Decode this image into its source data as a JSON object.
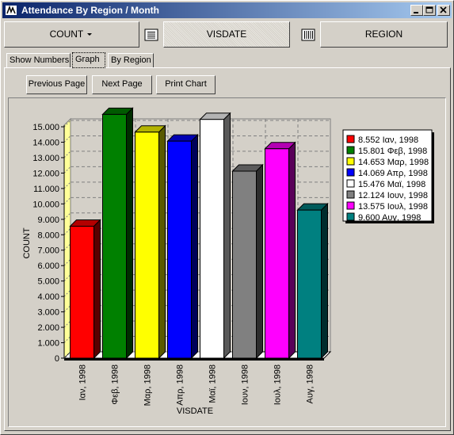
{
  "window": {
    "title": "Attendance By Region / Month"
  },
  "toolbar": {
    "count_label": "COUNT",
    "visdate_label": "VISDATE",
    "region_label": "REGION"
  },
  "tabs": [
    {
      "label": "Show Numbers",
      "selected": false
    },
    {
      "label": "Graph",
      "selected": true
    },
    {
      "label": "By Region",
      "selected": false
    }
  ],
  "nav": {
    "previous_label": "Previous Page",
    "next_label": "Next Page",
    "print_label": "Print Chart"
  },
  "chart_data": {
    "type": "bar",
    "categories": [
      "Ιαν, 1998",
      "Φεβ, 1998",
      "Μαρ, 1998",
      "Απρ, 1998",
      "Μαϊ, 1998",
      "Ιουν, 1998",
      "Ιουλ, 1998",
      "Αυγ, 1998"
    ],
    "values": [
      8552,
      15801,
      14653,
      14069,
      15476,
      12124,
      13575,
      9600
    ],
    "colors": [
      "#ff0000",
      "#008000",
      "#ffff00",
      "#0000ff",
      "#ffffff",
      "#808080",
      "#ff00ff",
      "#008080"
    ],
    "legend": [
      "8.552 Ιαν, 1998",
      "15.801 Φεβ, 1998",
      "14.653 Μαρ, 1998",
      "14.069 Απρ, 1998",
      "15.476 Μαϊ, 1998",
      "12.124 Ιουν, 1998",
      "13.575 Ιουλ, 1998",
      "9.600 Αυγ, 1998"
    ],
    "yticks": [
      "0",
      "1.000",
      "2.000",
      "3.000",
      "4.000",
      "5.000",
      "6.000",
      "7.000",
      "8.000",
      "9.000",
      "10.000",
      "11.000",
      "12.000",
      "13.000",
      "14.000",
      "15.000"
    ],
    "xlabel": "VISDATE",
    "ylabel": "COUNT",
    "ylim": [
      0,
      15000
    ],
    "grid": true,
    "legend_position": "right"
  }
}
